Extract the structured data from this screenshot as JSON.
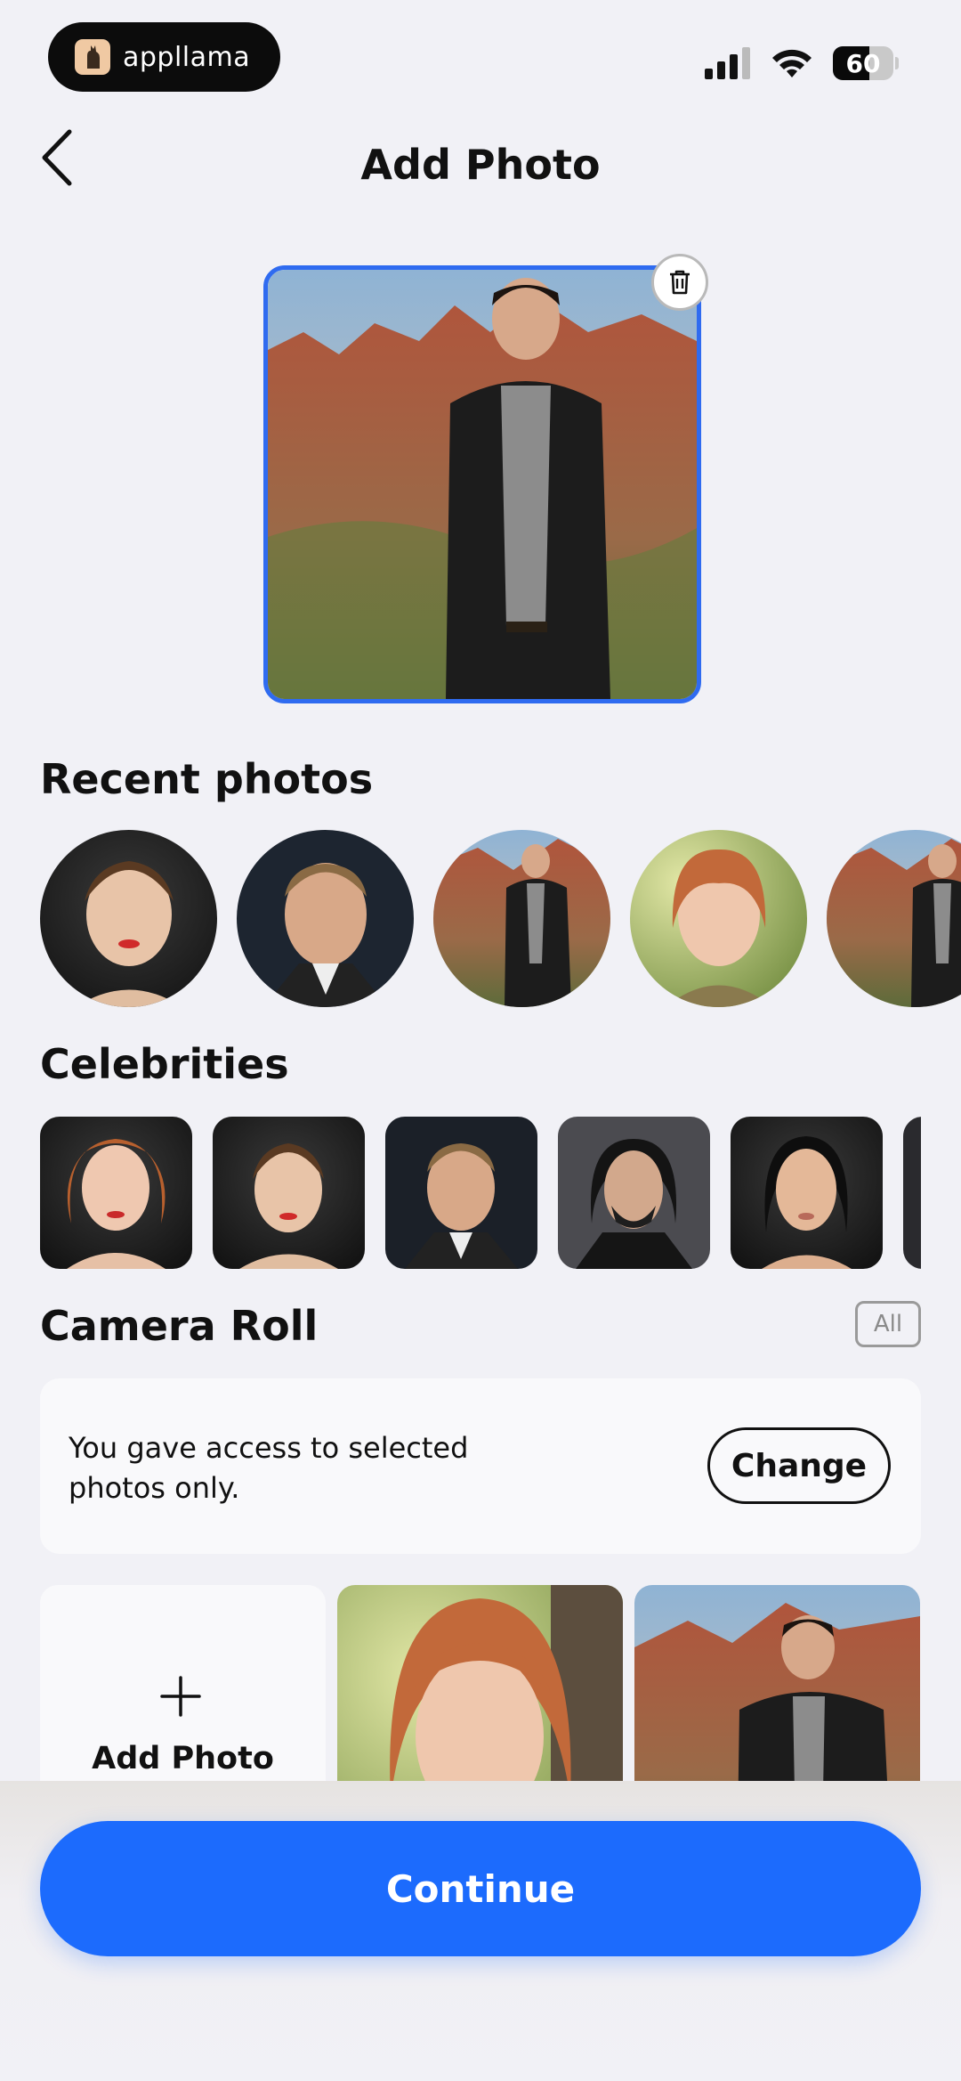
{
  "status_bar": {
    "brand": "appllama",
    "battery_level": "60",
    "battery_fraction": 0.6
  },
  "header": {
    "title": "Add Photo"
  },
  "recent": {
    "title": "Recent photos"
  },
  "celebrities": {
    "title": "Celebrities"
  },
  "camera_roll": {
    "title": "Camera Roll",
    "all_label": "All",
    "access_message": "You gave access to selected photos only.",
    "change_label": "Change",
    "add_photo_label": "Add Photo"
  },
  "footer": {
    "continue_label": "Continue"
  },
  "colors": {
    "accent": "#1c6bfd",
    "selection_border": "#2f6bf0"
  }
}
